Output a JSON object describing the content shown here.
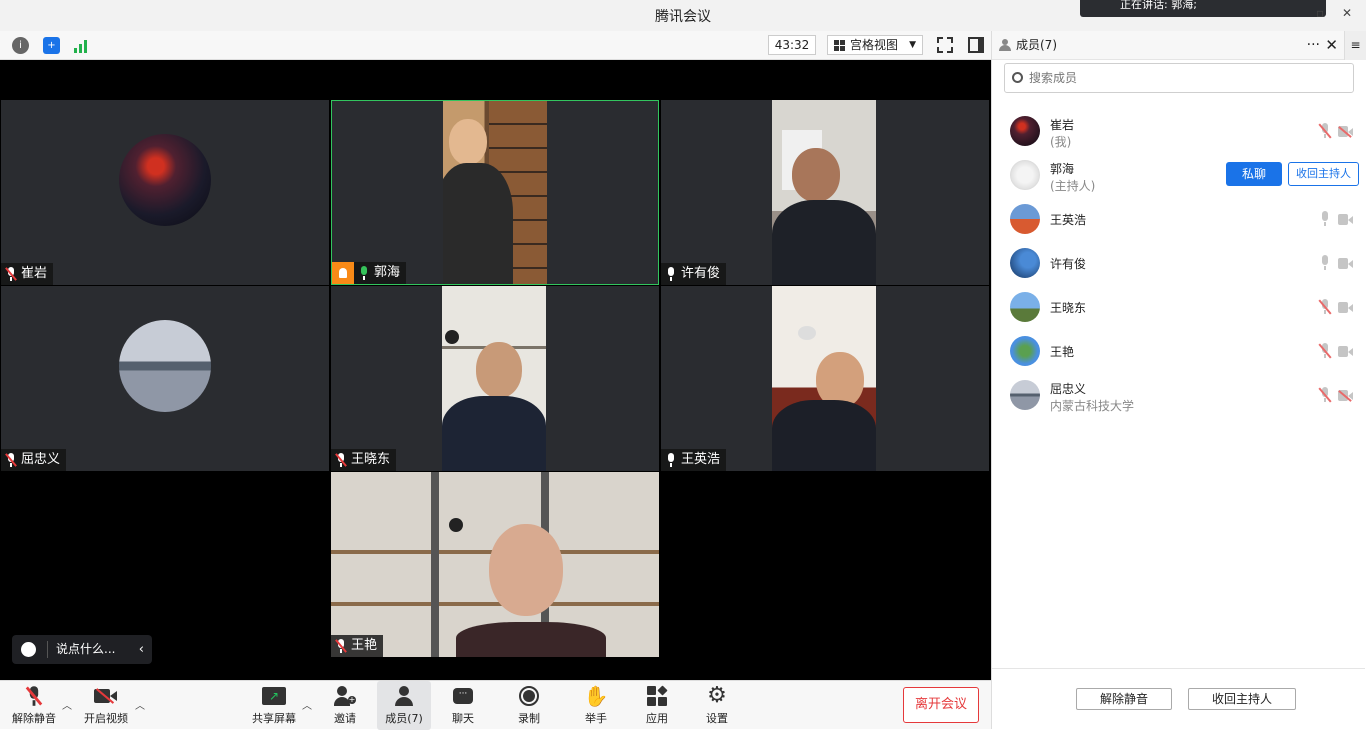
{
  "window": {
    "title": "腾讯会议",
    "notification": "正在讲话: 郭海;"
  },
  "toolbar": {
    "timer": "43:32",
    "view_mode": "宫格视图"
  },
  "tiles": [
    {
      "name": "崔岩",
      "muted": true
    },
    {
      "name": "郭海",
      "muted": false,
      "host": true
    },
    {
      "name": "许有俊",
      "muted": false
    },
    {
      "name": "屈忠义",
      "muted": true
    },
    {
      "name": "王晓东",
      "muted": true
    },
    {
      "name": "王英浩",
      "muted": false
    },
    {
      "name": "王艳",
      "muted": true
    }
  ],
  "chat_input": {
    "placeholder": "说点什么..."
  },
  "bottom": {
    "unmute": "解除静音",
    "start_video": "开启视频",
    "share": "共享屏幕",
    "invite": "邀请",
    "members": "成员(7)",
    "chat": "聊天",
    "record": "录制",
    "raise_hand": "举手",
    "apps": "应用",
    "settings": "设置",
    "leave": "离开会议"
  },
  "panel": {
    "title": "成员(7)",
    "search_placeholder": "搜索成员",
    "members": [
      {
        "name": "崔岩",
        "sub": "(我)",
        "mic_muted": true,
        "cam_off": true
      },
      {
        "name": "郭海",
        "sub": "(主持人)",
        "pm": "私聊",
        "revoke": "收回主持人"
      },
      {
        "name": "王英浩",
        "sub": "",
        "mic_muted": false,
        "cam_off": false
      },
      {
        "name": "许有俊",
        "sub": "",
        "mic_muted": false,
        "cam_off": false
      },
      {
        "name": "王晓东",
        "sub": "",
        "mic_muted": true,
        "cam_off": false
      },
      {
        "name": "王艳",
        "sub": "",
        "mic_muted": true,
        "cam_off": false
      },
      {
        "name": "屈忠义",
        "sub": "内蒙古科技大学",
        "mic_muted": true,
        "cam_off": true
      }
    ],
    "footer": {
      "unmute_all": "解除静音",
      "revoke_host": "收回主持人"
    }
  }
}
